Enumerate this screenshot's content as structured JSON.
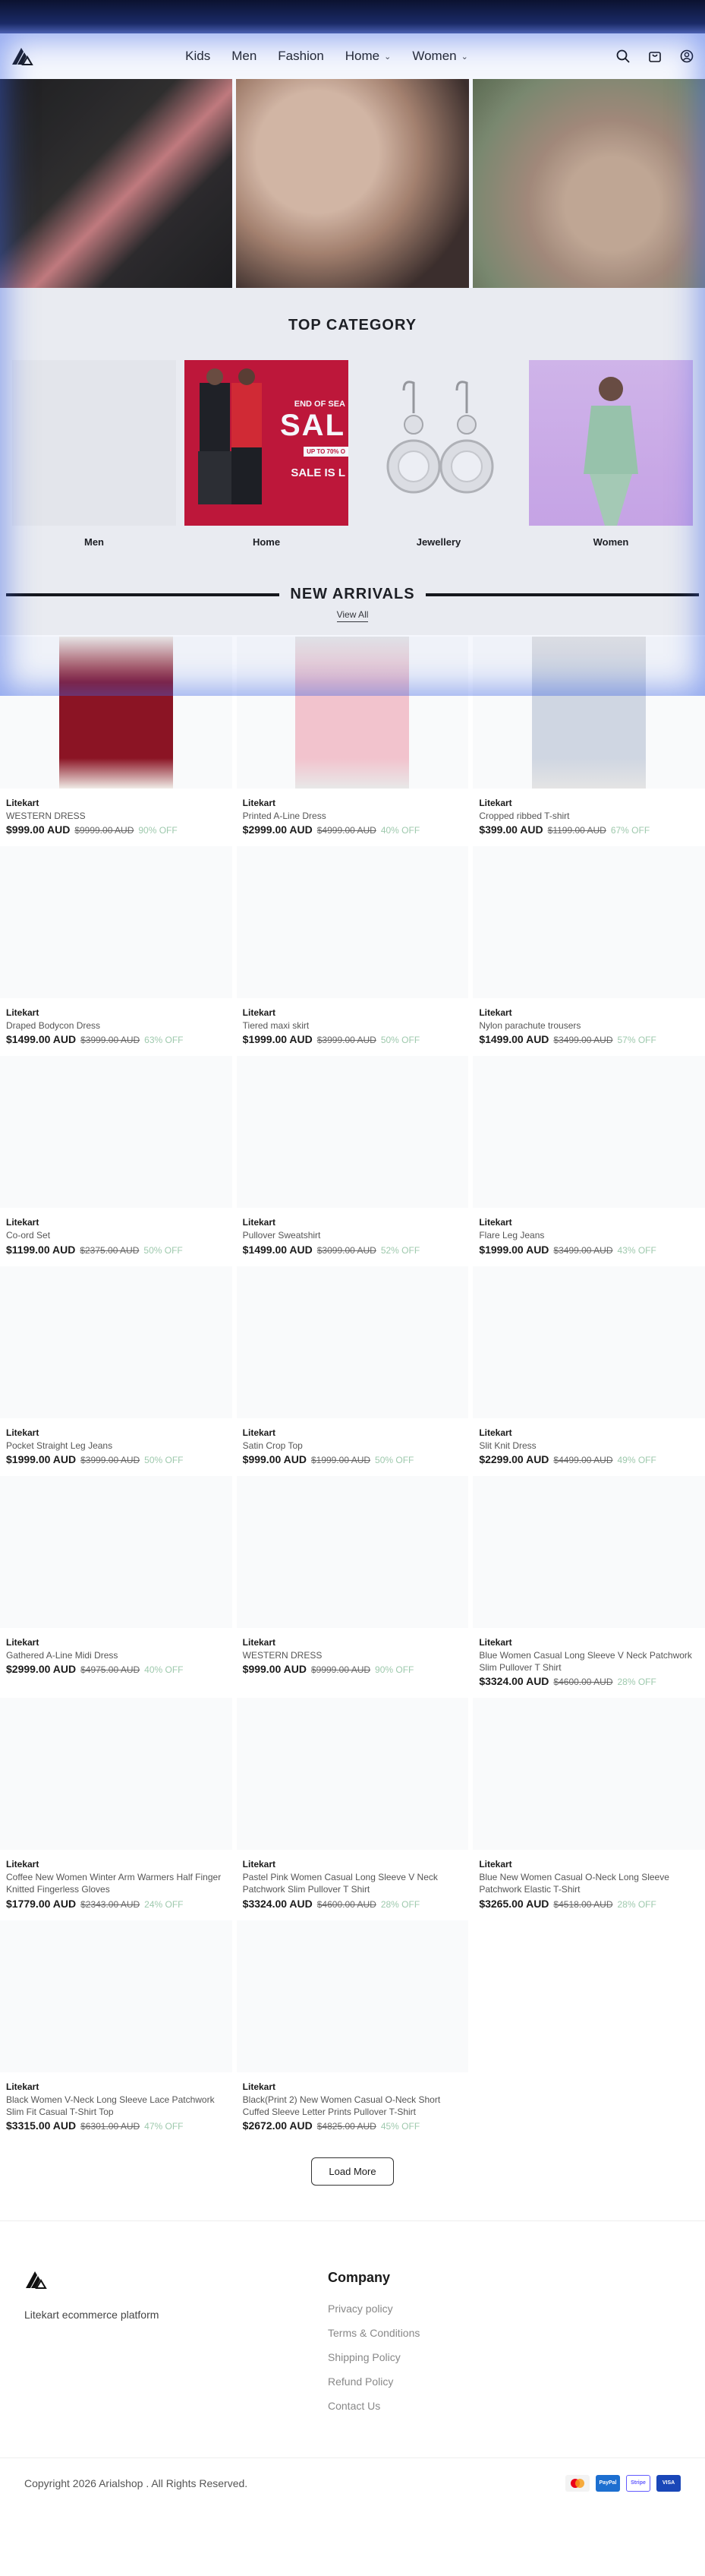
{
  "nav": {
    "items": [
      {
        "label": "Kids"
      },
      {
        "label": "Men"
      },
      {
        "label": "Fashion"
      },
      {
        "label": "Home"
      },
      {
        "label": "Women"
      }
    ]
  },
  "top_category": {
    "title": "TOP CATEGORY",
    "items": [
      {
        "label": "Men"
      },
      {
        "label": "Home"
      },
      {
        "label": "Jewellery"
      },
      {
        "label": "Women"
      }
    ],
    "home_banner": {
      "line1": "END OF SEA",
      "line2": "SAL",
      "line3": "UP TO 70% O",
      "line4": "SALE IS L"
    }
  },
  "new_arrivals": {
    "title": "NEW ARRIVALS",
    "view_all": "View All"
  },
  "products": [
    {
      "brand": "Litekart",
      "name": "WESTERN DRESS",
      "price": "$999.00 AUD",
      "old": "$9999.00 AUD",
      "off": "90% OFF"
    },
    {
      "brand": "Litekart",
      "name": "Printed A-Line Dress",
      "price": "$2999.00 AUD",
      "old": "$4999.00 AUD",
      "off": "40% OFF"
    },
    {
      "brand": "Litekart",
      "name": "Cropped ribbed T-shirt",
      "price": "$399.00 AUD",
      "old": "$1199.00 AUD",
      "off": "67% OFF"
    },
    {
      "brand": "Litekart",
      "name": "Draped Bodycon Dress",
      "price": "$1499.00 AUD",
      "old": "$3999.00 AUD",
      "off": "63% OFF"
    },
    {
      "brand": "Litekart",
      "name": "Tiered maxi skirt",
      "price": "$1999.00 AUD",
      "old": "$3999.00 AUD",
      "off": "50% OFF"
    },
    {
      "brand": "Litekart",
      "name": "Nylon parachute trousers",
      "price": "$1499.00 AUD",
      "old": "$3499.00 AUD",
      "off": "57% OFF"
    },
    {
      "brand": "Litekart",
      "name": "Co-ord Set",
      "price": "$1199.00 AUD",
      "old": "$2375.00 AUD",
      "off": "50% OFF"
    },
    {
      "brand": "Litekart",
      "name": "Pullover Sweatshirt",
      "price": "$1499.00 AUD",
      "old": "$3099.00 AUD",
      "off": "52% OFF"
    },
    {
      "brand": "Litekart",
      "name": "Flare Leg Jeans",
      "price": "$1999.00 AUD",
      "old": "$3499.00 AUD",
      "off": "43% OFF"
    },
    {
      "brand": "Litekart",
      "name": "Pocket Straight Leg Jeans",
      "price": "$1999.00 AUD",
      "old": "$3999.00 AUD",
      "off": "50% OFF"
    },
    {
      "brand": "Litekart",
      "name": "Satin Crop Top",
      "price": "$999.00 AUD",
      "old": "$1999.00 AUD",
      "off": "50% OFF"
    },
    {
      "brand": "Litekart",
      "name": "Slit Knit Dress",
      "price": "$2299.00 AUD",
      "old": "$4499.00 AUD",
      "off": "49% OFF"
    },
    {
      "brand": "Litekart",
      "name": "Gathered A-Line Midi Dress",
      "price": "$2999.00 AUD",
      "old": "$4975.00 AUD",
      "off": "40% OFF"
    },
    {
      "brand": "Litekart",
      "name": "WESTERN DRESS",
      "price": "$999.00 AUD",
      "old": "$9999.00 AUD",
      "off": "90% OFF"
    },
    {
      "brand": "Litekart",
      "name": "Blue Women Casual Long Sleeve V Neck Patchwork Slim Pullover T Shirt",
      "price": "$3324.00 AUD",
      "old": "$4600.00 AUD",
      "off": "28% OFF"
    },
    {
      "brand": "Litekart",
      "name": "Coffee New Women Winter Arm Warmers Half Finger Knitted Fingerless Gloves",
      "price": "$1779.00 AUD",
      "old": "$2343.00 AUD",
      "off": "24% OFF"
    },
    {
      "brand": "Litekart",
      "name": "Pastel Pink Women Casual Long Sleeve V Neck Patchwork Slim Pullover T Shirt",
      "price": "$3324.00 AUD",
      "old": "$4600.00 AUD",
      "off": "28% OFF"
    },
    {
      "brand": "Litekart",
      "name": "Blue New Women Casual O-Neck Long Sleeve Patchwork Elastic T-Shirt",
      "price": "$3265.00 AUD",
      "old": "$4518.00 AUD",
      "off": "28% OFF"
    },
    {
      "brand": "Litekart",
      "name": "Black Women V-Neck Long Sleeve Lace Patchwork Slim Fit Casual T-Shirt Top",
      "price": "$3315.00 AUD",
      "old": "$6301.00 AUD",
      "off": "47% OFF"
    },
    {
      "brand": "Litekart",
      "name": "Black(Print 2) New Women Casual O-Neck Short Cuffed Sleeve Letter Prints Pullover T-Shirt",
      "price": "$2672.00 AUD",
      "old": "$4825.00 AUD",
      "off": "45% OFF"
    }
  ],
  "load_more": "Load More",
  "footer": {
    "tagline": "Litekart ecommerce platform",
    "company_title": "Company",
    "links": [
      {
        "label": "Privacy policy"
      },
      {
        "label": "Terms & Conditions"
      },
      {
        "label": "Shipping Policy"
      },
      {
        "label": "Refund Policy"
      },
      {
        "label": "Contact Us"
      }
    ],
    "copyright": "Copyright 2026 Arialshop . All Rights Reserved.",
    "payments": [
      {
        "label": "",
        "color": "#eb5a1e"
      },
      {
        "label": "PayPal",
        "color": "#1d6fd0"
      },
      {
        "label": "Stripe",
        "color": "#ffffff"
      },
      {
        "label": "VISA",
        "color": "#1a47b8"
      }
    ]
  }
}
